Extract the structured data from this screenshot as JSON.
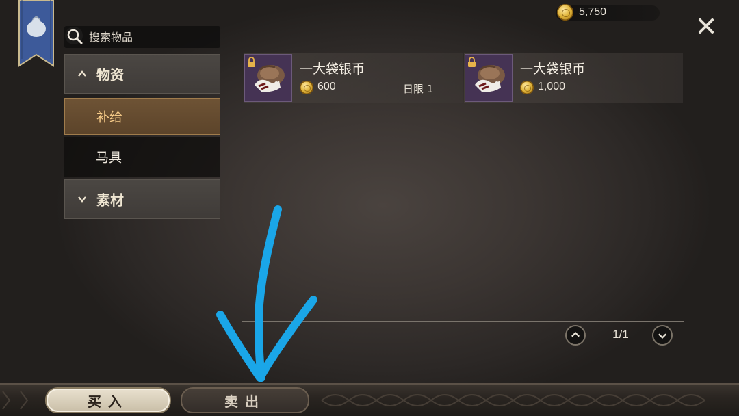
{
  "header": {
    "currency_amount": "5,750",
    "close_icon": "close-icon"
  },
  "search": {
    "placeholder": "搜索物品",
    "icon": "search-icon"
  },
  "sidebar": {
    "categories": [
      {
        "label": "物资",
        "expanded": true,
        "icon": "chevron-up-icon",
        "items": [
          {
            "label": "补给",
            "selected": true
          },
          {
            "label": "马具",
            "selected": false
          }
        ]
      },
      {
        "label": "素材",
        "expanded": false,
        "icon": "chevron-down-icon"
      }
    ]
  },
  "items": [
    {
      "name": "一大袋银币",
      "price": "600",
      "limit": "日限 1",
      "locked": true,
      "icon": "silver-coin-bag-icon"
    },
    {
      "name": "一大袋银币",
      "price": "1,000",
      "limit": "",
      "locked": true,
      "icon": "silver-coin-bag-icon"
    }
  ],
  "pagination": {
    "indicator": "1/1"
  },
  "bottom_tabs": {
    "buy_label": "买入",
    "sell_label": "卖出",
    "active": "buy"
  },
  "colors": {
    "annotation_arrow": "#1aa6e8",
    "selected_subcategory_text": "#f4c987",
    "item_thumb_bg": "#453354"
  }
}
